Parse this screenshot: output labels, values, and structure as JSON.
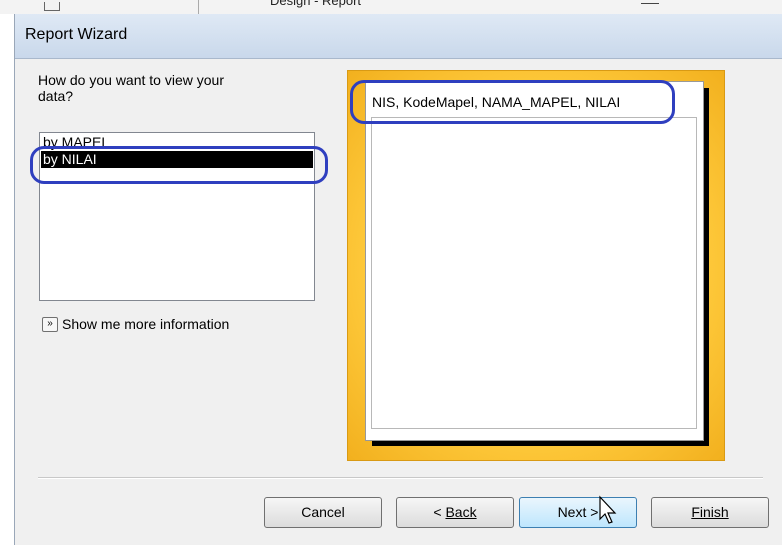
{
  "background": {
    "title_fragment": "Design - Report"
  },
  "dialog": {
    "title": "Report Wizard",
    "prompt": "How do you want to view your\ndata?",
    "view_options": [
      {
        "label": "by MAPEL",
        "selected": false
      },
      {
        "label": "by NILAI",
        "selected": true
      }
    ],
    "more_info_icon": "double-chevron-right-icon",
    "more_info_label": "Show me more information",
    "preview": {
      "fields_line": "NIS, KodeMapel, NAMA_MAPEL, NILAI"
    },
    "buttons": {
      "cancel": "Cancel",
      "back_prefix": "< ",
      "back_label": "Back",
      "next_label": "Next >",
      "finish_label": "Finish"
    }
  },
  "colors": {
    "annotation": "#2f3fbf",
    "preview_background": "#ffcb3d",
    "selected_item": "#000000"
  }
}
